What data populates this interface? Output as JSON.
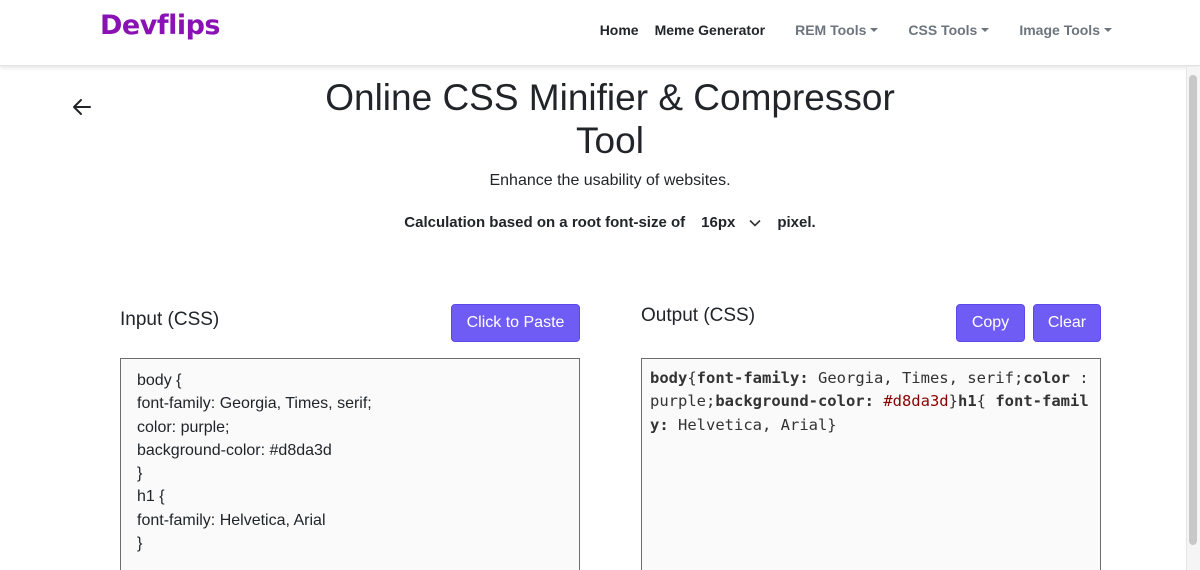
{
  "navbar": {
    "logo": "Devflips",
    "links": [
      {
        "label": "Home",
        "dropdown": false
      },
      {
        "label": "Meme Generator",
        "dropdown": false
      },
      {
        "label": "REM Tools",
        "dropdown": true
      },
      {
        "label": "CSS Tools",
        "dropdown": true
      },
      {
        "label": "Image Tools",
        "dropdown": true
      }
    ]
  },
  "page": {
    "back_icon": "arrow-left-icon",
    "title_line1": "Online CSS Minifier & Compressor",
    "title_line2": "Tool",
    "subtitle": "Enhance the usability of websites.",
    "calc_prefix": "Calculation based on a root font-size of",
    "font_size_value": "16px",
    "calc_suffix": "pixel."
  },
  "input_panel": {
    "label": "Input (CSS)",
    "paste_button": "Click to Paste",
    "lines": [
      "body {",
      "font-family: Georgia, Times, serif;",
      "color: purple;",
      "background-color: #d8da3d",
      "}",
      "h1 {",
      "font-family: Helvetica, Arial",
      "}"
    ]
  },
  "output_panel": {
    "label": "Output (CSS)",
    "copy_button": "Copy",
    "clear_button": "Clear",
    "tokens": [
      {
        "t": "body",
        "k": "kw"
      },
      {
        "t": "{",
        "k": ""
      },
      {
        "t": "font-family:",
        "k": "kw"
      },
      {
        "t": " Georgia, Times, serif;",
        "k": ""
      },
      {
        "t": "color",
        "k": "kw"
      },
      {
        "t": " : purple;",
        "k": ""
      },
      {
        "t": "background-color:",
        "k": "kw"
      },
      {
        "t": " ",
        "k": ""
      },
      {
        "t": "#d8da3d",
        "k": "hex"
      },
      {
        "t": "}",
        "k": ""
      },
      {
        "t": "h1",
        "k": "kw"
      },
      {
        "t": "{ ",
        "k": ""
      },
      {
        "t": "font-family:",
        "k": "kw"
      },
      {
        "t": " Helvetica, Arial}",
        "k": ""
      }
    ]
  },
  "colors": {
    "accent": "#6f5cf4",
    "logo": "#8a12b5",
    "hex_token": "#8b0000"
  }
}
